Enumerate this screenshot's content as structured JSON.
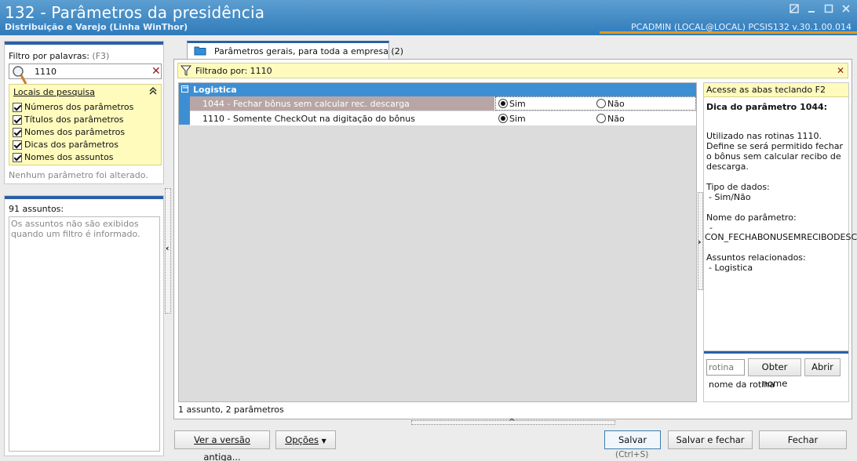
{
  "window": {
    "title": "132 - Parâmetros da presidência",
    "subtitle": "Distribuição e Varejo (Linha WinThor)",
    "status": "PCADMIN (LOCAL@LOCAL)  PCSIS132  v.30.1.00.014"
  },
  "filter": {
    "label": "Filtro por palavras:",
    "shortcut": "(F3)",
    "value": "1110",
    "locations_title": "Locais de pesquisa",
    "locations": [
      "Números dos parâmetros",
      "Títulos dos parâmetros",
      "Nomes dos parâmetros",
      "Dicas dos parâmetros",
      "Nomes dos assuntos"
    ],
    "no_change": "Nenhum parâmetro foi alterado."
  },
  "subjects": {
    "count_label": "91 assuntos:",
    "hidden_msg": "Os assuntos não são exibidos quando um filtro é informado."
  },
  "tab": {
    "label": "Parâmetros gerais, para toda a empresa  (2)"
  },
  "filter_bar": {
    "text": "Filtrado por: 1110"
  },
  "grid": {
    "group": "Logistica",
    "rows": [
      {
        "title": "1044 - Fechar bônus sem calcular rec. descarga",
        "yes": "Sim",
        "no": "Não",
        "selected": "yes"
      },
      {
        "title": "1110 - Somente CheckOut na digitação do bônus",
        "yes": "Sim",
        "no": "Não",
        "selected": "yes"
      }
    ],
    "footer": "1 assunto, 2 parâmetros"
  },
  "tip": {
    "header": "Acesse as abas teclando F2",
    "title": "Dica do parâmetro 1044:",
    "description": "Utilizado nas rotinas 1110. Define se será permitido fechar o bônus sem calcular recibo de descarga.",
    "type_label": "Tipo de dados:",
    "type_value": "- Sim/Não",
    "name_label": "Nome do parâmetro:",
    "name_dash": "-",
    "name_value": "CON_FECHABONUSEMRECIBODESC",
    "subjects_label": "Assuntos relacionados:",
    "subjects_value": "- Logistica"
  },
  "routine": {
    "placeholder": "rotina",
    "get_name": "Obter nome",
    "open": "Abrir",
    "name_label": "nome da rotina"
  },
  "footer_buttons": {
    "old_version": "Ver a versão antiga...",
    "options": "Opções",
    "save": "Salvar",
    "save_shortcut": "(Ctrl+S)",
    "save_close": "Salvar e fechar",
    "close": "Fechar"
  }
}
